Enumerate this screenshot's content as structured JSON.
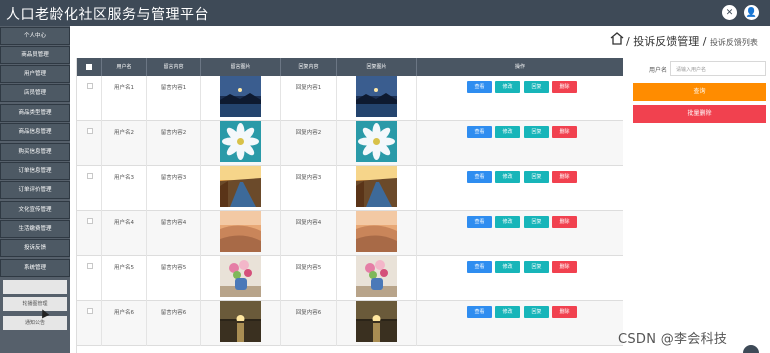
{
  "app": {
    "title": "人口老龄化社区服务与管理平台",
    "icons": [
      "close-icon",
      "user-icon"
    ],
    "icon_glyphs": {
      "close": "✕",
      "user": "👤"
    }
  },
  "sidebar": {
    "items": [
      {
        "label": "个人中心",
        "style": "main"
      },
      {
        "label": "商品员管理",
        "style": "main"
      },
      {
        "label": "用户管理",
        "style": "main"
      },
      {
        "label": "店员管理",
        "style": "main"
      },
      {
        "label": "商品类型管理",
        "style": "main"
      },
      {
        "label": "商品信息管理",
        "style": "main"
      },
      {
        "label": "购买信息管理",
        "style": "main"
      },
      {
        "label": "订单信息管理",
        "style": "main"
      },
      {
        "label": "订单评价管理",
        "style": "main"
      },
      {
        "label": "文化宣传管理",
        "style": "main"
      },
      {
        "label": "生活缴费管理",
        "style": "main"
      },
      {
        "label": "投诉反馈",
        "style": "main"
      },
      {
        "label": "系统管理",
        "style": "main"
      },
      {
        "label": "",
        "style": "sub"
      },
      {
        "label": "轮播图管理",
        "style": "sub"
      },
      {
        "label": "通知公告",
        "style": "sub"
      }
    ]
  },
  "breadcrumb": {
    "home_icon": "home-icon",
    "sep1": "/",
    "current": "投诉反馈管理",
    "sep2": "/",
    "page": "投诉反馈列表"
  },
  "table": {
    "headers": [
      "",
      "用户名",
      "留言内容",
      "留言图片",
      "回复内容",
      "回复图片",
      "操作"
    ],
    "rows": [
      {
        "username": "用户名1",
        "message": "留言内容1",
        "reply": "回复内容1",
        "image_type": "night-lake"
      },
      {
        "username": "用户名2",
        "message": "留言内容2",
        "reply": "回复内容2",
        "image_type": "white-flower"
      },
      {
        "username": "用户名3",
        "message": "留言内容3",
        "reply": "回复内容3",
        "image_type": "road-sunset"
      },
      {
        "username": "用户名4",
        "message": "留言内容4",
        "reply": "回复内容4",
        "image_type": "desert-dunes"
      },
      {
        "username": "用户名5",
        "message": "留言内容5",
        "reply": "回复内容5",
        "image_type": "flower-vase"
      },
      {
        "username": "用户名6",
        "message": "留言内容6",
        "reply": "回复内容6",
        "image_type": "sea-sunset"
      }
    ],
    "actions": {
      "view": "查看",
      "edit": "修改",
      "reply": "回复",
      "delete": "删除"
    }
  },
  "search": {
    "label": "用户名",
    "placeholder": "请输入用户名",
    "query_button": "查询",
    "batch_delete_button": "批量删除"
  },
  "colors": {
    "topbar": "#3e4a57",
    "sidebar": "#56606b",
    "table_header": "#4a5663",
    "view": "#2f8df0",
    "edit": "#17b5b9",
    "delete": "#f1414f",
    "query": "#ff8c00",
    "batch_delete": "#f1414f"
  },
  "watermark": "CSDN @李会科技"
}
